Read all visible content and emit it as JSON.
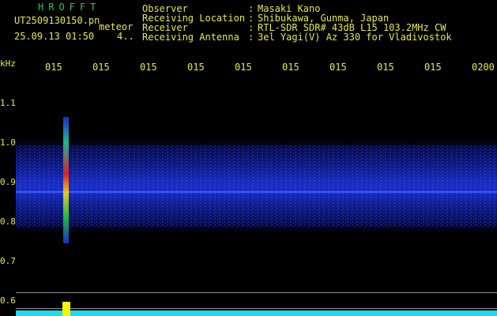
{
  "header": {
    "logo": "HROFFT",
    "file_name": "UT2509130150.pn",
    "file_suffix": "meteor",
    "date_time": "25.09.13 01:50    4.."
  },
  "info": {
    "rows": [
      {
        "label": "Observer",
        "sep": ":",
        "value": "Masaki Kano"
      },
      {
        "label": "Receiving Location",
        "sep": ":",
        "value": "Shibukawa, Gunma, Japan"
      },
      {
        "label": "Receiver",
        "sep": ":",
        "value": "RTL-SDR SDR# 43dB L15 103.2MHz CW"
      },
      {
        "label": "Receiving Antenna",
        "sep": ":",
        "value": "3el Yagi(V) Az 330 for Vladivostok"
      }
    ]
  },
  "time_axis": {
    "labels": [
      "015",
      "015",
      "015",
      "015",
      "015",
      "015",
      "015",
      "015",
      "015",
      "0200"
    ]
  },
  "freq_axis": {
    "unit": "kHz",
    "labels": [
      "1.1",
      "1.0",
      "0.9",
      "0.8",
      "0.7",
      "0.6"
    ]
  },
  "colors": {
    "text": "#e8e84a",
    "logo": "#22c94a",
    "noise_band": "#1a2fd0",
    "meteor_core": "#e02020",
    "level": "#22d8f0",
    "level_peak": "#f5f500"
  },
  "spectrogram": {
    "band_center_khz": 0.9,
    "band_width_khz": 0.2,
    "meteor_position": 0.1
  }
}
